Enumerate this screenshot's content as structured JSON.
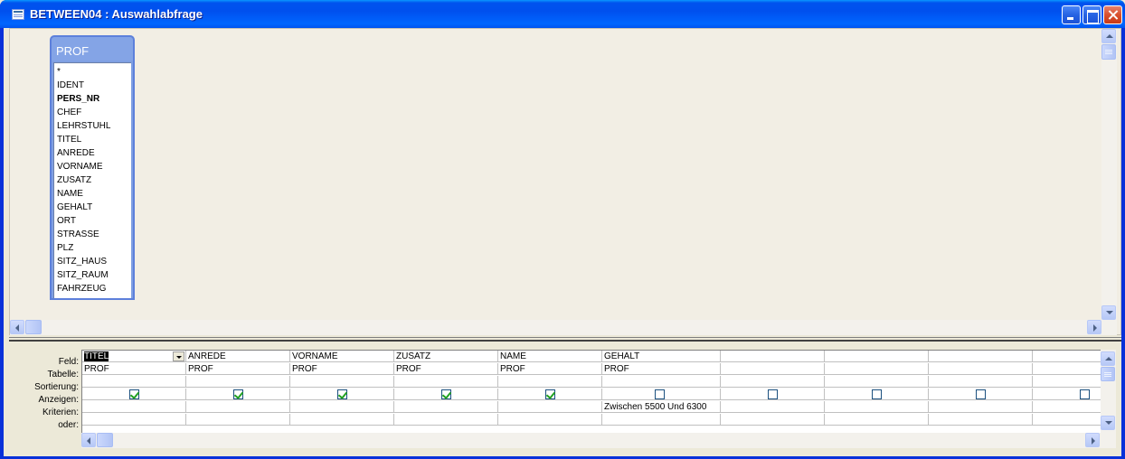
{
  "window": {
    "title": "BETWEEN04 : Auswahlabfrage"
  },
  "field_list": {
    "table_name": "PROF",
    "fields": [
      "*",
      "IDENT",
      "PERS_NR",
      "CHEF",
      "LEHRSTUHL",
      "TITEL",
      "ANREDE",
      "VORNAME",
      "ZUSATZ",
      "NAME",
      "GEHALT",
      "ORT",
      "STRASSE",
      "PLZ",
      "SITZ_HAUS",
      "SITZ_RAUM",
      "FAHRZEUG"
    ],
    "bold_field": "PERS_NR"
  },
  "grid": {
    "row_labels": {
      "field": "Feld:",
      "table": "Tabelle:",
      "sort": "Sortierung:",
      "show": "Anzeigen:",
      "criteria": "Kriterien:",
      "or": "oder:"
    },
    "columns": [
      {
        "field": "TITEL",
        "table": "PROF",
        "sort": "",
        "show": true,
        "criteria": "",
        "or": ""
      },
      {
        "field": "ANREDE",
        "table": "PROF",
        "sort": "",
        "show": true,
        "criteria": "",
        "or": ""
      },
      {
        "field": "VORNAME",
        "table": "PROF",
        "sort": "",
        "show": true,
        "criteria": "",
        "or": ""
      },
      {
        "field": "ZUSATZ",
        "table": "PROF",
        "sort": "",
        "show": true,
        "criteria": "",
        "or": ""
      },
      {
        "field": "NAME",
        "table": "PROF",
        "sort": "",
        "show": true,
        "criteria": "",
        "or": ""
      },
      {
        "field": "GEHALT",
        "table": "PROF",
        "sort": "",
        "show": false,
        "criteria": "Zwischen 5500 Und 6300",
        "or": ""
      },
      {
        "field": "",
        "table": "",
        "sort": "",
        "show": false,
        "criteria": "",
        "or": ""
      },
      {
        "field": "",
        "table": "",
        "sort": "",
        "show": false,
        "criteria": "",
        "or": ""
      },
      {
        "field": "",
        "table": "",
        "sort": "",
        "show": false,
        "criteria": "",
        "or": ""
      },
      {
        "field": "",
        "table": "",
        "sort": "",
        "show": false,
        "criteria": "",
        "or": ""
      }
    ]
  }
}
